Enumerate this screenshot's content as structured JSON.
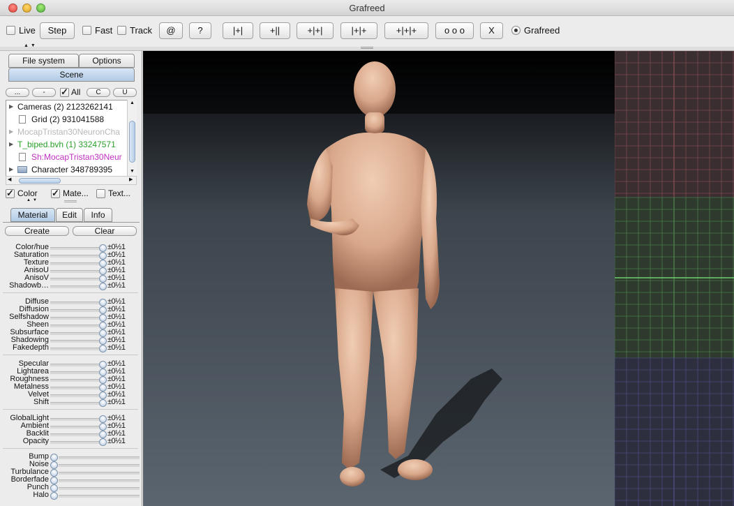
{
  "window": {
    "title": "Grafreed"
  },
  "toolbar": {
    "live_label": "Live",
    "step_label": "Step",
    "fast_label": "Fast",
    "track_label": "Track",
    "at_label": "@",
    "help_label": "?",
    "btn_1": "|+|",
    "btn_2": "+||",
    "btn_3": "+|+|",
    "btn_4": "|+|+",
    "btn_5": "+|+|+",
    "btn_6": "o o o",
    "close_label": "X",
    "grafreed_label": "Grafreed"
  },
  "left_tabs": {
    "file_system": "File system",
    "options": "Options",
    "scene": "Scene"
  },
  "tree_toolbar": {
    "b1": "...",
    "b2": "-",
    "all_label": "All",
    "b3": "C",
    "b4": "U"
  },
  "tree": [
    {
      "label": "Cameras (2) 2123262141",
      "color": "#111111"
    },
    {
      "label": "Grid (2) 931041588",
      "color": "#111111"
    },
    {
      "label": "MocapTristan30NeuronCha",
      "color": "#b8b8b8"
    },
    {
      "label": "T_biped.bvh (1) 33247571",
      "color": "#2aa02a"
    },
    {
      "label": "Sh:MocapTristan30Neur",
      "color": "#c030c0"
    },
    {
      "label": "Character 348789395",
      "color": "#111111"
    }
  ],
  "options": {
    "color_label": "Color",
    "material_label": "Mate...",
    "texture_label": "Text..."
  },
  "sub_tabs": {
    "material": "Material",
    "edit": "Edit",
    "info": "Info"
  },
  "actions": {
    "create": "Create",
    "clear": "Clear"
  },
  "param_symbol": "±0½1",
  "groups": [
    [
      "Color/hue",
      "Saturation",
      "Texture",
      "AnisoU",
      "AnisoV",
      "Shadowb…"
    ],
    [
      "Diffuse",
      "Diffusion",
      "Selfshadow",
      "Sheen",
      "Subsurface",
      "Shadowing",
      "Fakedepth"
    ],
    [
      "Specular",
      "Lightarea",
      "Roughness",
      "Metalness",
      "Velvet",
      "Shift"
    ],
    [
      "GlobalLight",
      "Ambient",
      "Backlit",
      "Opacity"
    ]
  ],
  "bottom_params": [
    "Bump",
    "Noise",
    "Turbulance",
    "Borderfade",
    "Punch",
    "Halo"
  ]
}
